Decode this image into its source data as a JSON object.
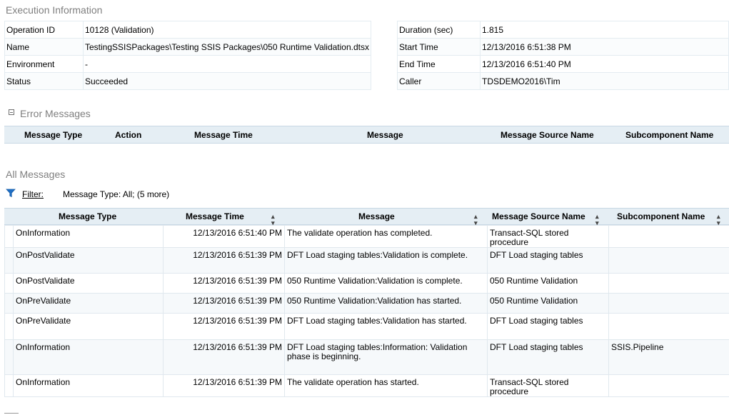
{
  "execution": {
    "title": "Execution Information",
    "left": [
      {
        "label": "Operation ID",
        "value": "10128 (Validation)"
      },
      {
        "label": "Name",
        "value": "TestingSSISPackages\\Testing SSIS Packages\\050 Runtime Validation.dtsx"
      },
      {
        "label": "Environment",
        "value": "-"
      },
      {
        "label": "Status",
        "value": "Succeeded"
      }
    ],
    "right": [
      {
        "label": "Duration (sec)",
        "value": "1.815"
      },
      {
        "label": "Start Time",
        "value": "12/13/2016 6:51:38 PM"
      },
      {
        "label": "End Time",
        "value": "12/13/2016 6:51:40 PM"
      },
      {
        "label": "Caller",
        "value": "TDSDEMO2016\\Tim"
      }
    ]
  },
  "errors": {
    "title": "Error Messages",
    "columns": [
      "Message Type",
      "Action",
      "Message Time",
      "Message",
      "Message Source Name",
      "Subcomponent Name"
    ]
  },
  "all": {
    "title": "All Messages",
    "filter_label": "Filter:",
    "filter_value": "Message Type: All;  (5 more)",
    "columns": [
      "Message Type",
      "Message Time",
      "Message",
      "Message Source Name",
      "Subcomponent Name"
    ],
    "rows": [
      {
        "type": "OnInformation",
        "time": "12/13/2016 6:51:40 PM",
        "message": "The validate operation has completed.",
        "source": "Transact-SQL stored procedure",
        "sub": ""
      },
      {
        "type": "OnPostValidate",
        "time": "12/13/2016 6:51:39 PM",
        "message": "DFT Load staging tables:Validation is complete.",
        "source": "DFT Load staging tables",
        "sub": ""
      },
      {
        "type": "OnPostValidate",
        "time": "12/13/2016 6:51:39 PM",
        "message": "050 Runtime Validation:Validation is complete.",
        "source": "050 Runtime Validation",
        "sub": ""
      },
      {
        "type": "OnPreValidate",
        "time": "12/13/2016 6:51:39 PM",
        "message": "050 Runtime Validation:Validation has started.",
        "source": "050 Runtime Validation",
        "sub": ""
      },
      {
        "type": "OnPreValidate",
        "time": "12/13/2016 6:51:39 PM",
        "message": "DFT Load staging tables:Validation has started.",
        "source": "DFT Load staging tables",
        "sub": ""
      },
      {
        "type": "OnInformation",
        "time": "12/13/2016 6:51:39 PM",
        "message": "DFT Load staging tables:Information: Validation phase is beginning.",
        "source": "DFT Load staging tables",
        "sub": "SSIS.Pipeline"
      },
      {
        "type": "OnInformation",
        "time": "12/13/2016 6:51:39 PM",
        "message": "The validate operation has started.",
        "source": "Transact-SQL stored procedure",
        "sub": ""
      }
    ]
  },
  "colors": {
    "header_bg": "#e5eef4",
    "border": "#d0dde6",
    "title": "#7f7f7f",
    "filter_icon": "#1f6fc5"
  }
}
